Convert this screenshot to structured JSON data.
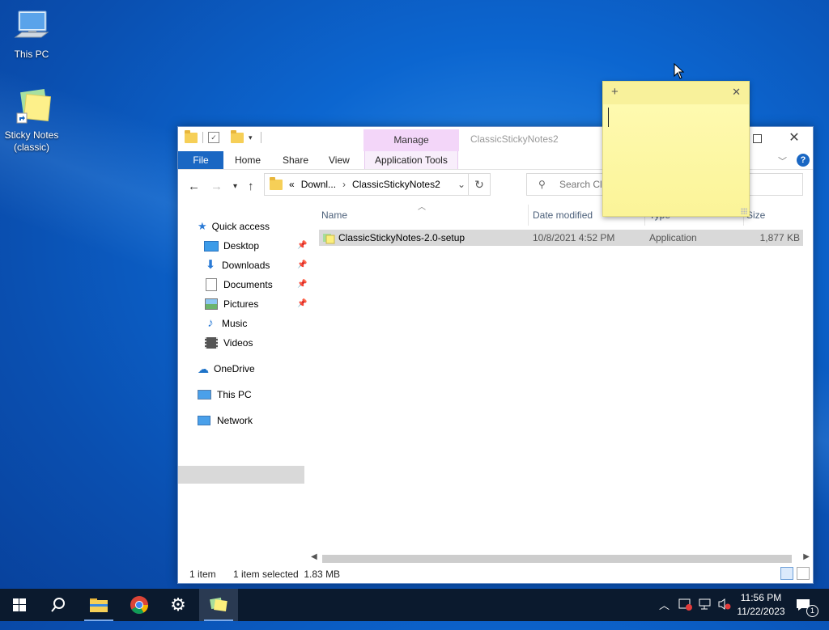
{
  "desktop": {
    "icons": [
      {
        "label": "This PC"
      },
      {
        "label": "Sticky Notes (classic)"
      }
    ]
  },
  "explorer": {
    "title": "ClassicStickyNotes2",
    "contextual_tab": "Manage",
    "ribbon_tabs": {
      "file": "File",
      "home": "Home",
      "share": "Share",
      "view": "View",
      "app_tools": "Application Tools"
    },
    "address": {
      "overflow": "«",
      "segments": [
        "Downl...",
        "ClassicStickyNotes2"
      ]
    },
    "search": {
      "placeholder": "Search ClassicStickyNotes2"
    },
    "nav": {
      "quick_access": "Quick access",
      "items": [
        {
          "label": "Desktop",
          "pinned": true
        },
        {
          "label": "Downloads",
          "pinned": true
        },
        {
          "label": "Documents",
          "pinned": true
        },
        {
          "label": "Pictures",
          "pinned": true
        },
        {
          "label": "Music",
          "pinned": false
        },
        {
          "label": "Videos",
          "pinned": false
        }
      ],
      "onedrive": "OneDrive",
      "this_pc": "This PC",
      "network": "Network"
    },
    "columns": {
      "name": "Name",
      "date": "Date modified",
      "type": "Type",
      "size": "Size"
    },
    "files": [
      {
        "name": "ClassicStickyNotes-2.0-setup",
        "date": "10/8/2021 4:52 PM",
        "type": "Application",
        "size": "1,877 KB"
      }
    ],
    "status": {
      "count": "1 item",
      "selection": "1 item selected  1.83 MB"
    }
  },
  "sticky_note": {
    "text": ""
  },
  "taskbar": {
    "clock_time": "11:56 PM",
    "clock_date": "11/22/2023",
    "notification_count": "1"
  },
  "colors": {
    "accent": "#1a67c3",
    "manage_tab": "#f3d6f9",
    "sticky": "#fdf7a6",
    "taskbar": "#0b1a2e"
  }
}
